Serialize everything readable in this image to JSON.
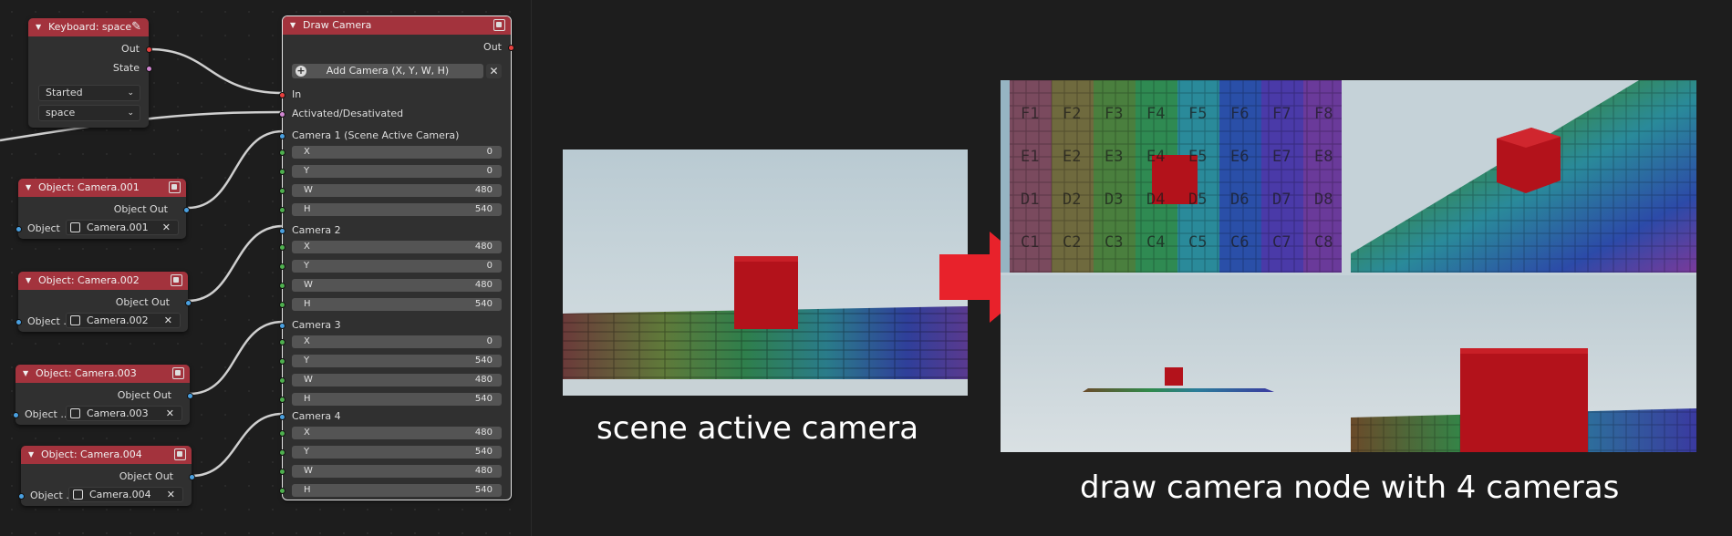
{
  "keyboard_node": {
    "title": "Keyboard: space",
    "out_label": "Out",
    "state_label": "State",
    "state_value": "Started",
    "key_value": "space"
  },
  "camera_nodes": [
    {
      "title": "Object: Camera.001",
      "out_label": "Object Out",
      "field_label": "Object",
      "object": "Camera.001"
    },
    {
      "title": "Object: Camera.002",
      "out_label": "Object Out",
      "field_label": "Object ...",
      "object": "Camera.002"
    },
    {
      "title": "Object: Camera.003",
      "out_label": "Object Out",
      "field_label": "Object ...",
      "object": "Camera.003"
    },
    {
      "title": "Object: Camera.004",
      "out_label": "Object Out",
      "field_label": "Object ...",
      "object": "Camera.004"
    }
  ],
  "draw_camera": {
    "title": "Draw Camera",
    "out_label": "Out",
    "add_label": "Add Camera (X, Y, W, H)",
    "in_label": "In",
    "activated_label": "Activated/Desativated",
    "cameras": [
      {
        "label": "Camera 1 (Scene Active Camera)",
        "fields": [
          {
            "k": "X",
            "v": "0"
          },
          {
            "k": "Y",
            "v": "0"
          },
          {
            "k": "W",
            "v": "480"
          },
          {
            "k": "H",
            "v": "540"
          }
        ]
      },
      {
        "label": "Camera 2",
        "fields": [
          {
            "k": "X",
            "v": "480"
          },
          {
            "k": "Y",
            "v": "0"
          },
          {
            "k": "W",
            "v": "480"
          },
          {
            "k": "H",
            "v": "540"
          }
        ]
      },
      {
        "label": "Camera 3",
        "fields": [
          {
            "k": "X",
            "v": "0"
          },
          {
            "k": "Y",
            "v": "540"
          },
          {
            "k": "W",
            "v": "480"
          },
          {
            "k": "H",
            "v": "540"
          }
        ]
      },
      {
        "label": "Camera 4",
        "fields": [
          {
            "k": "X",
            "v": "480"
          },
          {
            "k": "Y",
            "v": "540"
          },
          {
            "k": "W",
            "v": "480"
          },
          {
            "k": "H",
            "v": "540"
          }
        ]
      }
    ]
  },
  "grid_labels": {
    "F": [
      "F1",
      "F2",
      "F3",
      "F4",
      "F5",
      "F6",
      "F7",
      "F8"
    ],
    "E": [
      "E1",
      "E2",
      "E3",
      "E4",
      "E5",
      "E6",
      "E7",
      "E8"
    ],
    "D": [
      "D1",
      "D2",
      "D3",
      "D4",
      "D5",
      "D6",
      "D7",
      "D8"
    ],
    "C": [
      "C1",
      "C2",
      "C3",
      "C4",
      "C5",
      "C6",
      "C7",
      "C8"
    ]
  },
  "captions": {
    "left": "scene active camera",
    "right": "draw camera node with 4 cameras"
  },
  "colors": {
    "node_header": "#a3333d",
    "arrow": "#e8222b",
    "cube": "#b3121b",
    "sky": "#c9d6dc"
  }
}
